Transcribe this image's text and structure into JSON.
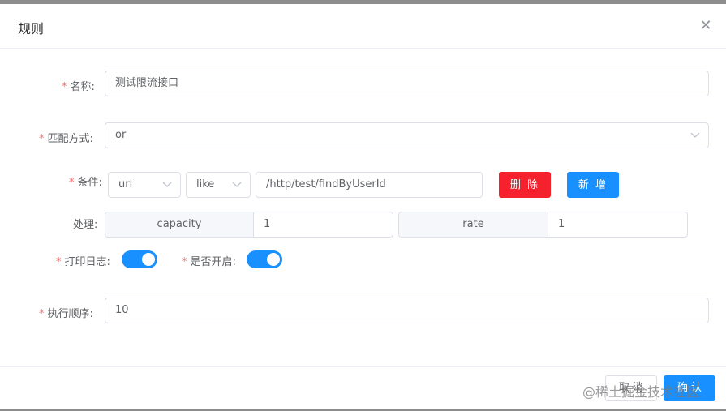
{
  "dialog": {
    "title": "规则",
    "close_icon": "close-icon"
  },
  "form": {
    "name": {
      "label": "名称:",
      "required": true,
      "value": "测试限流接口"
    },
    "match_mode": {
      "label": "匹配方式:",
      "required": true,
      "value": "or"
    },
    "condition": {
      "label": "条件:",
      "required": true,
      "field_select": "uri",
      "operator_select": "like",
      "value": "/http/test/findByUserId",
      "delete_label": "删 除",
      "add_label": "新 增"
    },
    "handler": {
      "label": "处理:",
      "capacity_label": "capacity",
      "capacity_value": "1",
      "rate_label": "rate",
      "rate_value": "1"
    },
    "log_switch": {
      "label": "打印日志:",
      "required": true,
      "on": true
    },
    "enabled_switch": {
      "label": "是否开启:",
      "required": true,
      "on": true
    },
    "order": {
      "label": "执行顺序:",
      "required": true,
      "value": "10"
    }
  },
  "footer": {
    "cancel_label": "取 消",
    "confirm_label": "确 认"
  },
  "watermark": "@稀土掘金技术社区",
  "colors": {
    "primary": "#1890ff",
    "danger": "#f5222d",
    "required": "#f56c6c"
  }
}
